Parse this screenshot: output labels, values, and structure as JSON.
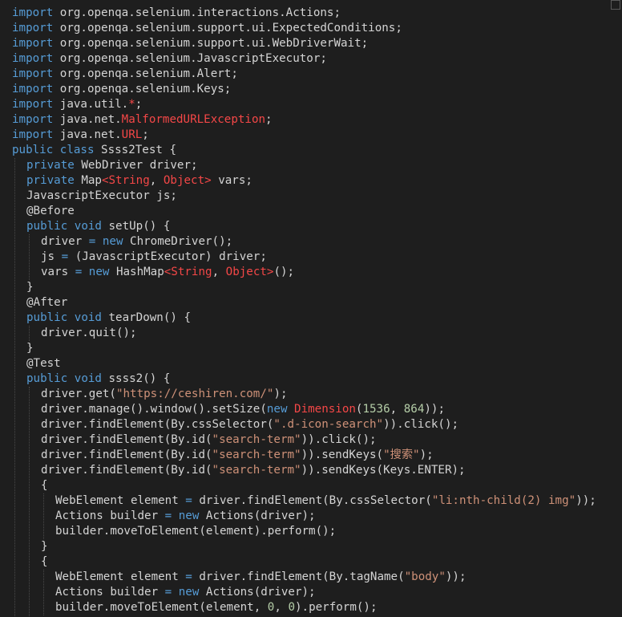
{
  "colors": {
    "background": "#1e1e1e",
    "text": "#d4d4d4",
    "keyword": "#569cd6",
    "type": "#f44747",
    "string": "#ce9178",
    "number": "#b5cea8",
    "guide": "#4a4a4a"
  },
  "lines": [
    {
      "indent": 0,
      "tokens": [
        [
          "import ",
          "k"
        ],
        [
          "org.openqa.selenium.interactions.Actions;",
          "p"
        ]
      ]
    },
    {
      "indent": 0,
      "tokens": [
        [
          "import ",
          "k"
        ],
        [
          "org.openqa.selenium.support.ui.ExpectedConditions;",
          "p"
        ]
      ]
    },
    {
      "indent": 0,
      "tokens": [
        [
          "import ",
          "k"
        ],
        [
          "org.openqa.selenium.support.ui.WebDriverWait;",
          "p"
        ]
      ]
    },
    {
      "indent": 0,
      "tokens": [
        [
          "import ",
          "k"
        ],
        [
          "org.openqa.selenium.JavascriptExecutor;",
          "p"
        ]
      ]
    },
    {
      "indent": 0,
      "tokens": [
        [
          "import ",
          "k"
        ],
        [
          "org.openqa.selenium.Alert;",
          "p"
        ]
      ]
    },
    {
      "indent": 0,
      "tokens": [
        [
          "import ",
          "k"
        ],
        [
          "org.openqa.selenium.Keys;",
          "p"
        ]
      ]
    },
    {
      "indent": 0,
      "tokens": [
        [
          "import ",
          "k"
        ],
        [
          "java.util.",
          "p"
        ],
        [
          "*",
          "t"
        ],
        [
          ";",
          "p"
        ]
      ]
    },
    {
      "indent": 0,
      "tokens": [
        [
          "import ",
          "k"
        ],
        [
          "java.net.",
          "p"
        ],
        [
          "MalformedURLException",
          "t"
        ],
        [
          ";",
          "p"
        ]
      ]
    },
    {
      "indent": 0,
      "tokens": [
        [
          "import ",
          "k"
        ],
        [
          "java.net.",
          "p"
        ],
        [
          "URL",
          "t"
        ],
        [
          ";",
          "p"
        ]
      ]
    },
    {
      "indent": 0,
      "tokens": [
        [
          "public class ",
          "k"
        ],
        [
          "Ssss2Test {",
          "p"
        ]
      ]
    },
    {
      "indent": 1,
      "tokens": [
        [
          "private ",
          "k"
        ],
        [
          "WebDriver driver;",
          "p"
        ]
      ]
    },
    {
      "indent": 1,
      "tokens": [
        [
          "private ",
          "k"
        ],
        [
          "Map",
          "p"
        ],
        [
          "<String",
          "t"
        ],
        [
          ", ",
          "p"
        ],
        [
          "Object>",
          "t"
        ],
        [
          " vars;",
          "p"
        ]
      ]
    },
    {
      "indent": 1,
      "tokens": [
        [
          "JavascriptExecutor js;",
          "p"
        ]
      ]
    },
    {
      "indent": 1,
      "tokens": [
        [
          "@Before",
          "p"
        ]
      ]
    },
    {
      "indent": 1,
      "tokens": [
        [
          "public void ",
          "k"
        ],
        [
          "setUp() {",
          "p"
        ]
      ]
    },
    {
      "indent": 2,
      "tokens": [
        [
          "driver ",
          "p"
        ],
        [
          "= new ",
          "k"
        ],
        [
          "ChromeDriver();",
          "p"
        ]
      ]
    },
    {
      "indent": 2,
      "tokens": [
        [
          "js ",
          "p"
        ],
        [
          "= ",
          "k"
        ],
        [
          "(JavascriptExecutor) driver;",
          "p"
        ]
      ]
    },
    {
      "indent": 2,
      "tokens": [
        [
          "vars ",
          "p"
        ],
        [
          "= new ",
          "k"
        ],
        [
          "HashMap",
          "p"
        ],
        [
          "<String",
          "t"
        ],
        [
          ", ",
          "p"
        ],
        [
          "Object>",
          "t"
        ],
        [
          "();",
          "p"
        ]
      ]
    },
    {
      "indent": 1,
      "tokens": [
        [
          "}",
          "p"
        ]
      ]
    },
    {
      "indent": 1,
      "tokens": [
        [
          "@After",
          "p"
        ]
      ]
    },
    {
      "indent": 1,
      "tokens": [
        [
          "public void ",
          "k"
        ],
        [
          "tearDown() {",
          "p"
        ]
      ]
    },
    {
      "indent": 2,
      "tokens": [
        [
          "driver.quit();",
          "p"
        ]
      ]
    },
    {
      "indent": 1,
      "tokens": [
        [
          "}",
          "p"
        ]
      ]
    },
    {
      "indent": 1,
      "tokens": [
        [
          "@Test",
          "p"
        ]
      ]
    },
    {
      "indent": 1,
      "tokens": [
        [
          "public void ",
          "k"
        ],
        [
          "ssss2() {",
          "p"
        ]
      ]
    },
    {
      "indent": 2,
      "tokens": [
        [
          "driver.get(",
          "p"
        ],
        [
          "\"https://ceshiren.com/\"",
          "s"
        ],
        [
          ");",
          "p"
        ]
      ]
    },
    {
      "indent": 2,
      "tokens": [
        [
          "driver.manage().window().setSize(",
          "p"
        ],
        [
          "new ",
          "k"
        ],
        [
          "Dimension",
          "t"
        ],
        [
          "(",
          "p"
        ],
        [
          "1536",
          "n"
        ],
        [
          ", ",
          "p"
        ],
        [
          "864",
          "n"
        ],
        [
          "));",
          "p"
        ]
      ]
    },
    {
      "indent": 2,
      "tokens": [
        [
          "driver.findElement(By.cssSelector(",
          "p"
        ],
        [
          "\".d-icon-search\"",
          "s"
        ],
        [
          ")).click();",
          "p"
        ]
      ]
    },
    {
      "indent": 2,
      "tokens": [
        [
          "driver.findElement(By.id(",
          "p"
        ],
        [
          "\"search-term\"",
          "s"
        ],
        [
          ")).click();",
          "p"
        ]
      ]
    },
    {
      "indent": 2,
      "tokens": [
        [
          "driver.findElement(By.id(",
          "p"
        ],
        [
          "\"search-term\"",
          "s"
        ],
        [
          ")).sendKeys(",
          "p"
        ],
        [
          "\"搜索\"",
          "s"
        ],
        [
          ");",
          "p"
        ]
      ]
    },
    {
      "indent": 2,
      "tokens": [
        [
          "driver.findElement(By.id(",
          "p"
        ],
        [
          "\"search-term\"",
          "s"
        ],
        [
          ")).sendKeys(Keys.ENTER);",
          "p"
        ]
      ]
    },
    {
      "indent": 2,
      "tokens": [
        [
          "{",
          "p"
        ]
      ]
    },
    {
      "indent": 3,
      "tokens": [
        [
          "WebElement element ",
          "p"
        ],
        [
          "= ",
          "k"
        ],
        [
          "driver.findElement(By.cssSelector(",
          "p"
        ],
        [
          "\"li:nth-child(2) img\"",
          "s"
        ],
        [
          "));",
          "p"
        ]
      ]
    },
    {
      "indent": 3,
      "tokens": [
        [
          "Actions builder ",
          "p"
        ],
        [
          "= new ",
          "k"
        ],
        [
          "Actions(driver);",
          "p"
        ]
      ]
    },
    {
      "indent": 3,
      "tokens": [
        [
          "builder.moveToElement(element).perform();",
          "p"
        ]
      ]
    },
    {
      "indent": 2,
      "tokens": [
        [
          "}",
          "p"
        ]
      ]
    },
    {
      "indent": 2,
      "tokens": [
        [
          "{",
          "p"
        ]
      ]
    },
    {
      "indent": 3,
      "tokens": [
        [
          "WebElement element ",
          "p"
        ],
        [
          "= ",
          "k"
        ],
        [
          "driver.findElement(By.tagName(",
          "p"
        ],
        [
          "\"body\"",
          "s"
        ],
        [
          "));",
          "p"
        ]
      ]
    },
    {
      "indent": 3,
      "tokens": [
        [
          "Actions builder ",
          "p"
        ],
        [
          "= new ",
          "k"
        ],
        [
          "Actions(driver);",
          "p"
        ]
      ]
    },
    {
      "indent": 3,
      "tokens": [
        [
          "builder.moveToElement(element, ",
          "p"
        ],
        [
          "0",
          "n"
        ],
        [
          ", ",
          "p"
        ],
        [
          "0",
          "n"
        ],
        [
          ").perform();",
          "p"
        ]
      ]
    },
    {
      "indent": 2,
      "tokens": [
        [
          "}",
          "p"
        ]
      ]
    }
  ]
}
